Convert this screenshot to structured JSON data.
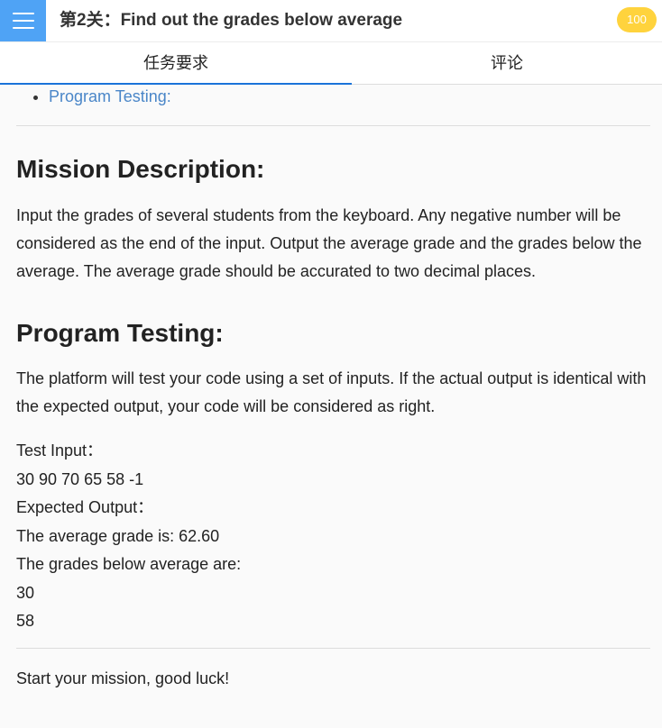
{
  "header": {
    "title": "第2关：Find out the grades below average",
    "score": "100"
  },
  "tabs": [
    {
      "label": "任务要求"
    },
    {
      "label": "评论"
    }
  ],
  "toc": {
    "items": [
      "Program Testing:"
    ]
  },
  "mission": {
    "heading": "Mission Description:",
    "text": "Input the grades of several students from the keyboard. Any negative number will be considered as the end of the input. Output the average grade and the grades below the average. The average grade should be accurated to two decimal places."
  },
  "testing": {
    "heading": "Program Testing:",
    "text": "The platform will test your code using a set of inputs. If the actual output is identical with the expected output, your code will be considered as right.",
    "lines": [
      "Test Input：",
      "30 90 70 65 58 -1",
      "Expected Output：",
      "The average grade is: 62.60",
      "The grades below average are:",
      "30",
      "58"
    ]
  },
  "footer": {
    "text": "Start your mission, good luck!"
  },
  "colors": {
    "menu": "#4fa3f5",
    "badge": "#ffd33d",
    "tab_active": "#1a73d9",
    "link": "#4a86c8"
  }
}
